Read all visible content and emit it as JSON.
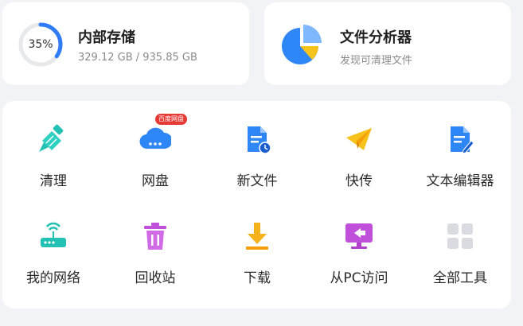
{
  "storage": {
    "title": "内部存储",
    "percent_label": "35%",
    "percent": 0.35,
    "usage": "329.12 GB / 935.85 GB"
  },
  "analyzer": {
    "title": "文件分析器",
    "subtitle": "发现可清理文件"
  },
  "tools": [
    {
      "label": "清理",
      "icon": "broom-icon"
    },
    {
      "label": "网盘",
      "icon": "cloud-drive-icon",
      "badge": "百度网盘"
    },
    {
      "label": "新文件",
      "icon": "new-file-icon"
    },
    {
      "label": "快传",
      "icon": "paper-plane-icon"
    },
    {
      "label": "文本编辑器",
      "icon": "text-editor-icon"
    },
    {
      "label": "我的网络",
      "icon": "router-icon"
    },
    {
      "label": "回收站",
      "icon": "trash-icon"
    },
    {
      "label": "下载",
      "icon": "download-icon"
    },
    {
      "label": "从PC访问",
      "icon": "pc-access-icon"
    },
    {
      "label": "全部工具",
      "icon": "all-tools-grid-icon"
    }
  ],
  "colors": {
    "accent_blue": "#2f7cf6",
    "teal": "#22c1b4",
    "yellow": "#f6c21c",
    "purple": "#c04fd9",
    "badge_red": "#e53935"
  }
}
